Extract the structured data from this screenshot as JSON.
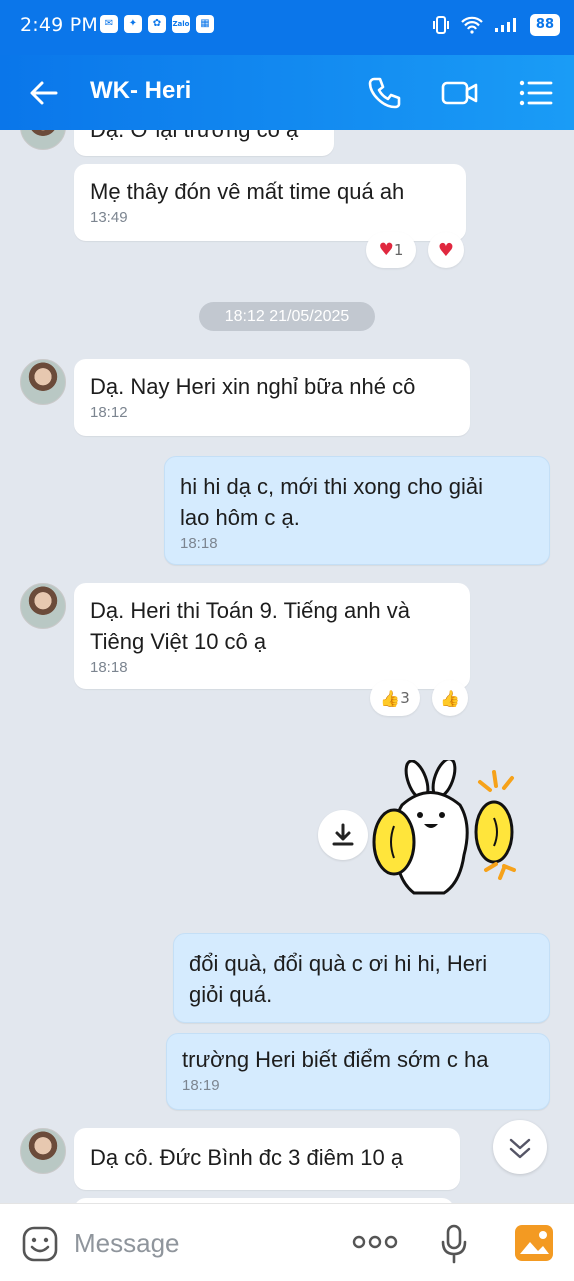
{
  "status_bar": {
    "time": "2:49 PM",
    "app_icons": [
      "messenger-icon",
      "game-icon",
      "pinwheel-icon",
      "zalo-icon",
      "calendar-icon"
    ],
    "battery": "88",
    "zalo_label": "Zalo"
  },
  "header": {
    "title": "WK- Heri",
    "icons": [
      "back-arrow-icon",
      "phone-icon",
      "video-call-icon",
      "menu-list-icon"
    ]
  },
  "messages": {
    "partial_top": {
      "text": "Dạ. Ở lại trường cô ạ"
    },
    "m1": {
      "text": "Mẹ thây đón vê mất time quá ah",
      "time": "13:49",
      "reaction_count": "1"
    },
    "date_separator": "18:12 21/05/2025",
    "m2": {
      "text": "Dạ. Nay Heri xin nghỉ bữa nhé cô",
      "time": "18:12"
    },
    "m3": {
      "text_line1": "hi hi dạ c, mới thi xong cho giải",
      "text_line2": "lao hôm c ạ.",
      "time": "18:18"
    },
    "m4": {
      "text_line1": "Dạ. Heri thi Toán 9. Tiếng anh và",
      "text_line2": "Tiêng Việt 10 cô ạ",
      "time": "18:18",
      "reaction_count": "3"
    },
    "m5": {
      "text_line1": "đổi quà, đổi quà c ơi hi hi, Heri",
      "text_line2": "giỏi quá."
    },
    "m6": {
      "text": "trường Heri biết điểm sớm c ha",
      "time": "18:19"
    },
    "m7": {
      "text": "Dạ cô. Đức Bình đc 3 điêm 10 ạ"
    }
  },
  "input": {
    "placeholder": "Message",
    "icons": [
      "emoji-icon",
      "more-options-icon",
      "microphone-icon",
      "image-gallery-icon"
    ]
  },
  "colors": {
    "header_blue": "#0b76ea",
    "my_bubble": "#d5ebfe",
    "chat_bg": "#e2e7ee"
  }
}
